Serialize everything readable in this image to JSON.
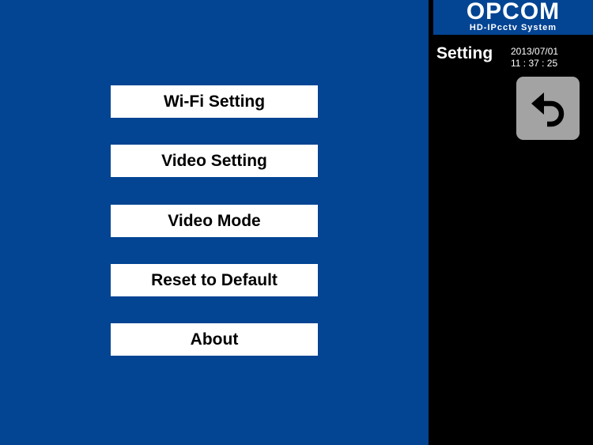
{
  "menu": {
    "items": [
      {
        "label": "Wi-Fi Setting"
      },
      {
        "label": "Video Setting"
      },
      {
        "label": "Video Mode"
      },
      {
        "label": "Reset to Default"
      },
      {
        "label": "About"
      }
    ]
  },
  "sidebar": {
    "brand": "OPCOM",
    "tagline": "HD-IPcctv System",
    "title": "Setting",
    "date": "2013/07/01",
    "time": "11 : 37 : 25",
    "back_icon": "back-arrow-icon"
  },
  "colors": {
    "main_background": "#034493",
    "side_background": "#000000",
    "button_background": "#ffffff",
    "back_button_background": "#a3a3a3"
  }
}
